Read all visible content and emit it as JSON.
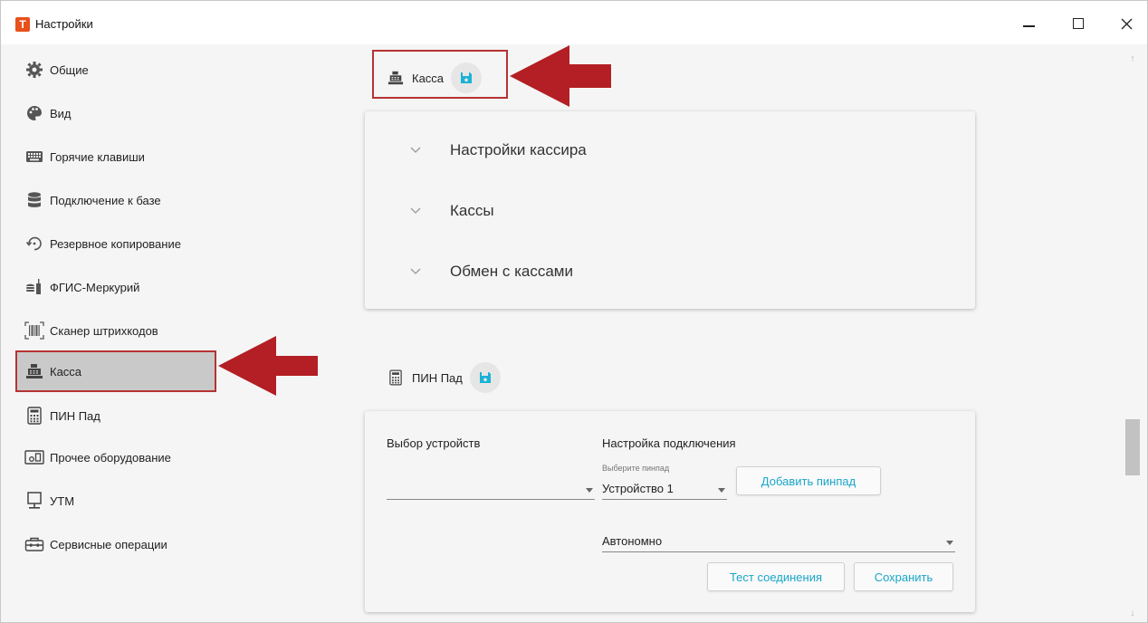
{
  "window": {
    "title": "Настройки",
    "app_icon_letter": "T",
    "accent": "#e8501c"
  },
  "sidebar": {
    "items": [
      {
        "label": "Общие",
        "icon": "gear-icon"
      },
      {
        "label": "Вид",
        "icon": "palette-icon"
      },
      {
        "label": "Горячие клавиши",
        "icon": "keyboard-icon"
      },
      {
        "label": "Подключение к базе",
        "icon": "database-icon"
      },
      {
        "label": "Резервное копирование",
        "icon": "backup-icon"
      },
      {
        "label": "ФГИС-Меркурий",
        "icon": "mercury-icon"
      },
      {
        "label": "Сканер штрихкодов",
        "icon": "barcode-icon"
      },
      {
        "label": "Касса",
        "icon": "cash-register-icon",
        "active": true
      },
      {
        "label": "ПИН Пад",
        "icon": "calculator-icon"
      },
      {
        "label": "Прочее оборудование",
        "icon": "equipment-icon"
      },
      {
        "label": "УТМ",
        "icon": "monitor-icon"
      },
      {
        "label": "Сервисные операции",
        "icon": "toolbox-icon"
      }
    ]
  },
  "kassa_section": {
    "title": "Касса",
    "accordion": [
      {
        "label": "Настройки кассира"
      },
      {
        "label": "Кассы"
      },
      {
        "label": "Обмен с кассами"
      }
    ]
  },
  "pinpad_section": {
    "title": "ПИН Пад",
    "device_select_label": "Выбор устройств",
    "device_select_value": "",
    "connection_label": "Настройка подключения",
    "pinpad_select_hint": "Выберите пинпад",
    "pinpad_select_value": "Устройство 1",
    "add_pinpad_button": "Добавить пинпад",
    "mode_select_value": "Автономно",
    "test_connection_button": "Тест соединения",
    "save_button": "Сохранить"
  },
  "colors": {
    "highlight_border": "#b53333",
    "arrow": "#b31f24",
    "button_text": "#19a6c9",
    "save_icon": "#1ab2d6"
  }
}
